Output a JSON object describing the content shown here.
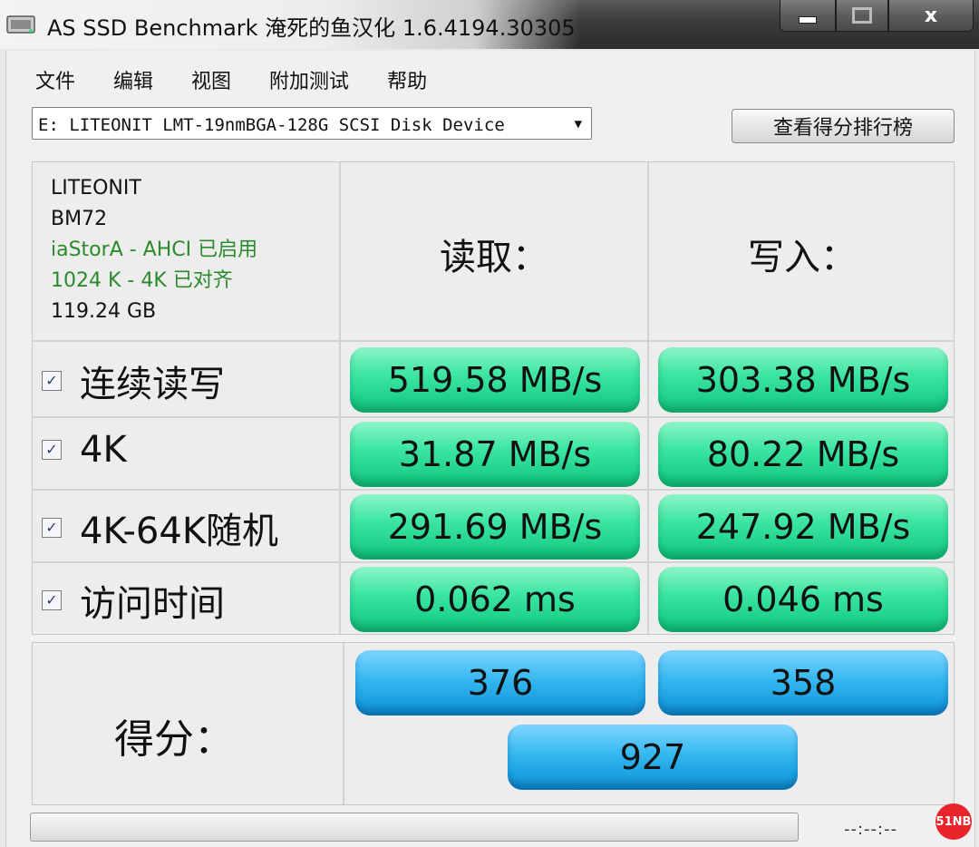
{
  "window": {
    "title": "AS SSD Benchmark 淹死的鱼汉化 1.6.4194.30305",
    "close_glyph": "x"
  },
  "menu": [
    "文件",
    "编辑",
    "视图",
    "附加测试",
    "帮助"
  ],
  "drive": {
    "selected": "E: LITEONIT LMT-19nmBGA-128G SCSI Disk Device"
  },
  "rank_button": "查看得分排行榜",
  "info": {
    "vendor": "LITEONIT",
    "firmware": "BM72",
    "driver": "iaStorA - AHCI 已启用",
    "alignment": "1024 K - 4K 已对齐",
    "capacity": "119.24 GB"
  },
  "headers": {
    "read": "读取：",
    "write": "写入："
  },
  "rows": [
    {
      "label": "连续读写",
      "read": "519.58 MB/s",
      "write": "303.38 MB/s"
    },
    {
      "label": "4K",
      "read": "31.87 MB/s",
      "write": "80.22 MB/s"
    },
    {
      "label": "4K-64K随机",
      "read": "291.69 MB/s",
      "write": "247.92 MB/s"
    },
    {
      "label": "访问时间",
      "read": "0.062 ms",
      "write": "0.046 ms"
    }
  ],
  "score": {
    "label": "得分：",
    "read": "376",
    "write": "358",
    "total": "927"
  },
  "status": {
    "timer": "--:--:--"
  },
  "watermark": "51NB",
  "colors": {
    "result_pill": "#2fdc98",
    "score_pill": "#1fa6e6",
    "driver_text": "#2b8a2b"
  }
}
